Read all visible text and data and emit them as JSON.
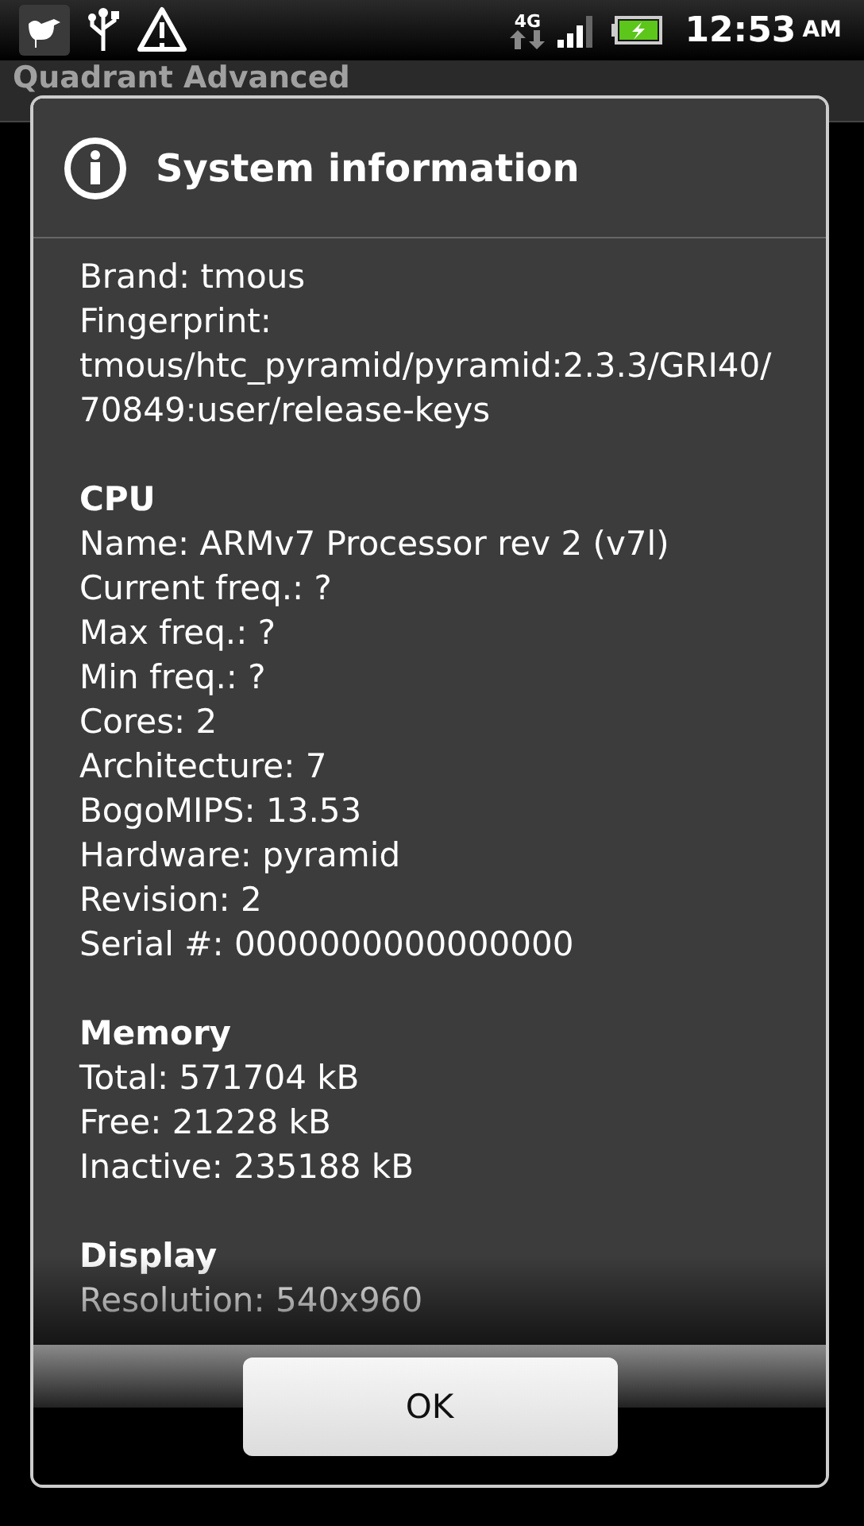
{
  "status_bar": {
    "network": "4G",
    "time": "12:53",
    "ampm": "AM"
  },
  "app": {
    "title": "Quadrant Advanced"
  },
  "dialog": {
    "title": "System information",
    "sections": [
      {
        "lines": [
          "Brand: tmous",
          "Fingerprint: tmous/htc_pyramid/pyramid:2.3.3/GRI40/70849:user/release-keys"
        ]
      },
      {
        "heading": "CPU",
        "lines": [
          "Name: ARMv7 Processor rev 2 (v7l)",
          "Current freq.: ?",
          "Max freq.: ?",
          "Min freq.: ?",
          "Cores: 2",
          "Architecture: 7",
          "BogoMIPS: 13.53",
          "Hardware: pyramid",
          "Revision: 2",
          "Serial #: 0000000000000000"
        ]
      },
      {
        "heading": "Memory",
        "lines": [
          "Total: 571704 kB",
          "Free: 21228 kB",
          "Inactive: 235188 kB"
        ]
      },
      {
        "heading": "Display",
        "lines": [
          "Resolution: 540x960"
        ]
      }
    ],
    "button": "OK"
  }
}
